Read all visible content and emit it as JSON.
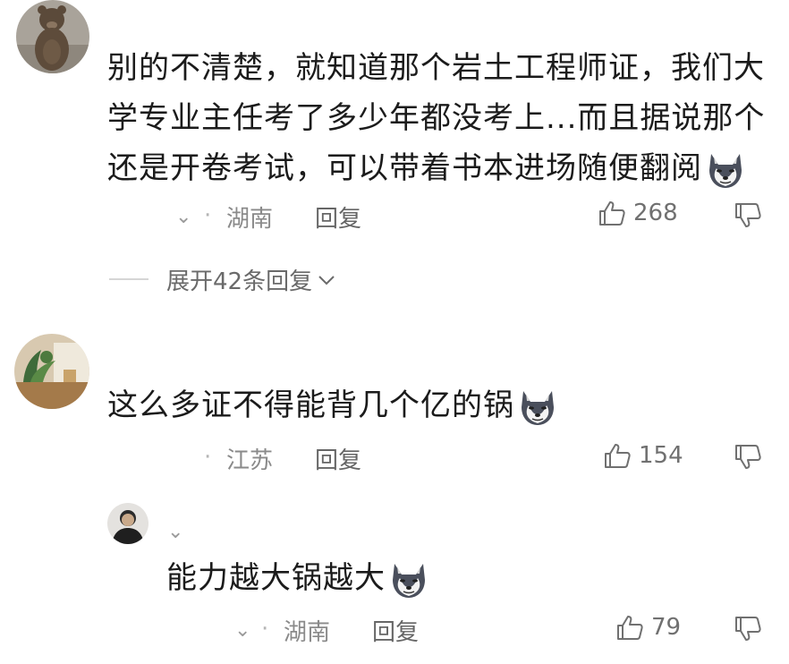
{
  "comments": [
    {
      "text_lines": [
        "别的不清楚，就知道那个岩土工程师证，我们大",
        "学专业主任考了多少年都没考上...而且据说那个",
        "还是开卷考试，可以带着书本进场随便翻阅"
      ],
      "emoji": "husky-dog-emoji",
      "location": "湖南",
      "reply_label": "回复",
      "likes": "268",
      "expand_replies": "展开42条回复"
    },
    {
      "text": "这么多证不得能背几个亿的锅",
      "emoji": "husky-dog-emoji",
      "location": "江苏",
      "reply_label": "回复",
      "likes": "154"
    },
    {
      "text": "能力越大锅越大",
      "emoji": "husky-dog-emoji",
      "location": "湖南",
      "reply_label": "回复",
      "likes": "79"
    }
  ],
  "icons": {
    "like": "thumb-up-icon",
    "dislike": "thumb-down-icon",
    "expand": "chevron-down-icon"
  },
  "colors": {
    "text": "#1b1b1b",
    "meta": "#8a8a8a",
    "divider": "#d6d6d6"
  }
}
